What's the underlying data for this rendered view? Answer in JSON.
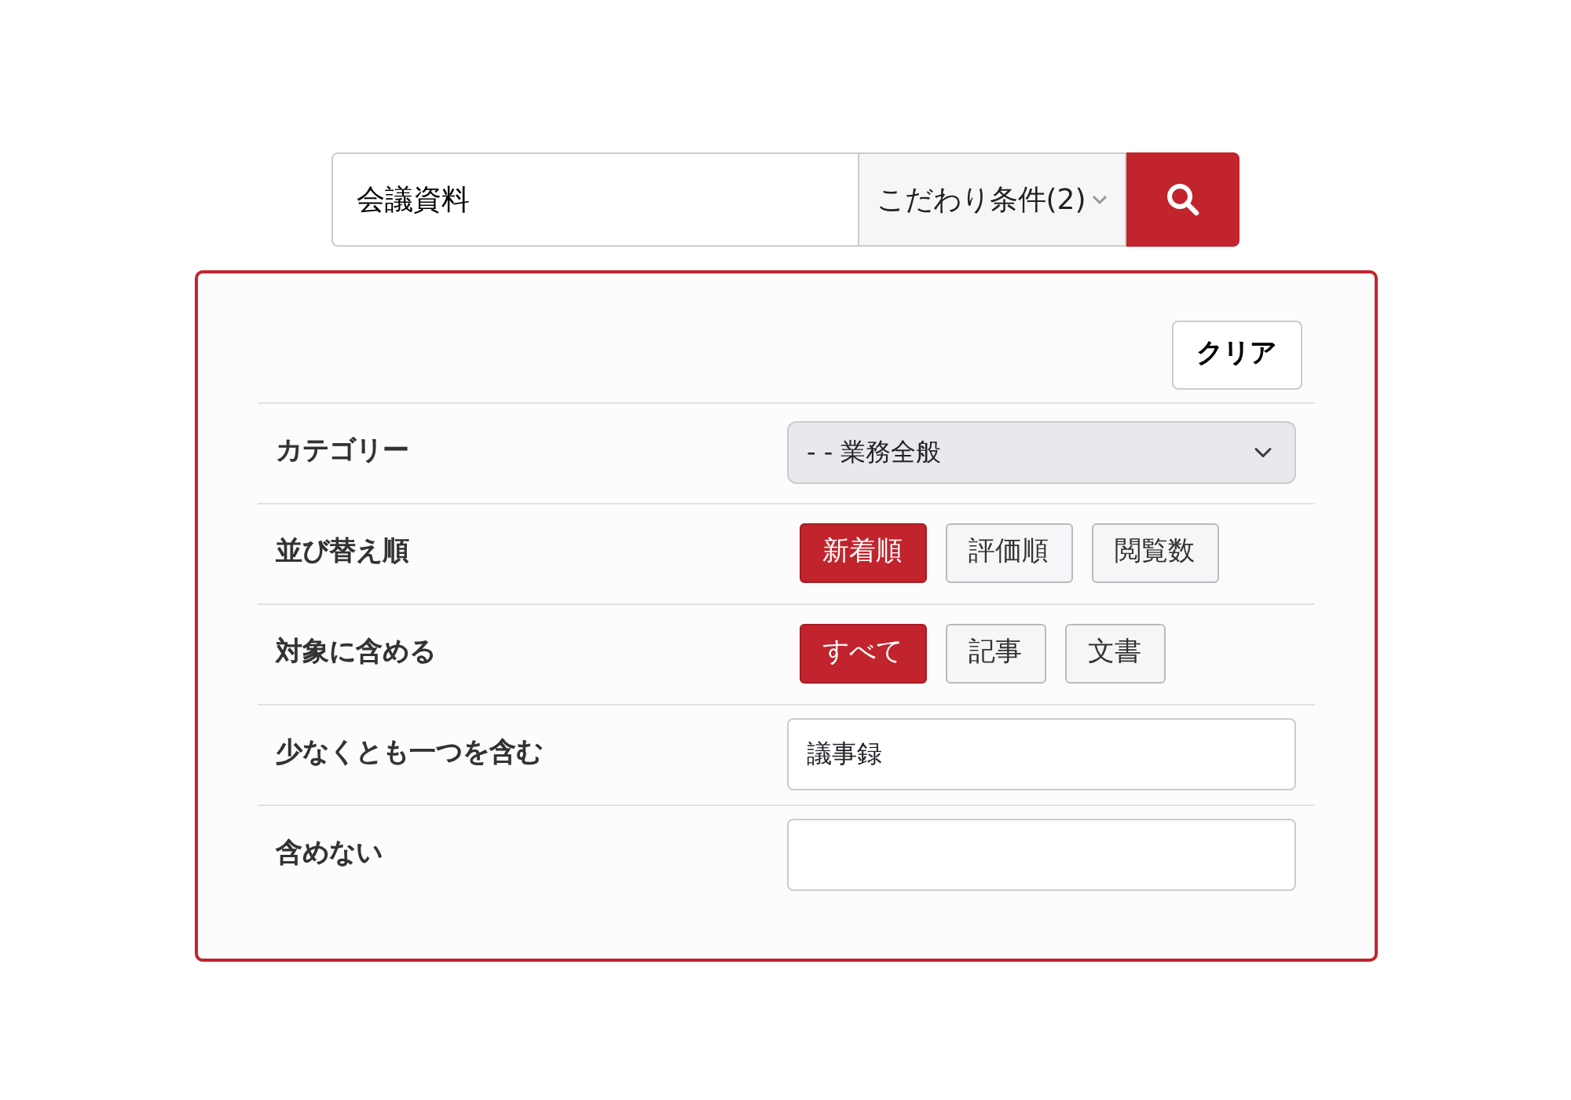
{
  "search": {
    "value": "会議資料",
    "filter_label": "こだわり条件(2)"
  },
  "panel": {
    "clear_label": "クリア",
    "rows": [
      {
        "kind": "select",
        "label": "カテゴリー",
        "value": "- - 業務全般"
      },
      {
        "kind": "toggle",
        "label": "並び替え順",
        "options": [
          {
            "label": "新着順",
            "selected": true
          },
          {
            "label": "評価順",
            "selected": false
          },
          {
            "label": "閲覧数",
            "selected": false
          }
        ]
      },
      {
        "kind": "toggle",
        "label": "対象に含める",
        "options": [
          {
            "label": "すべて",
            "selected": true
          },
          {
            "label": "記事",
            "selected": false
          },
          {
            "label": "文書",
            "selected": false
          }
        ]
      },
      {
        "kind": "text",
        "label": "少なくとも一つを含む",
        "value": "議事録"
      },
      {
        "kind": "text",
        "label": "含めない"
      }
    ]
  }
}
